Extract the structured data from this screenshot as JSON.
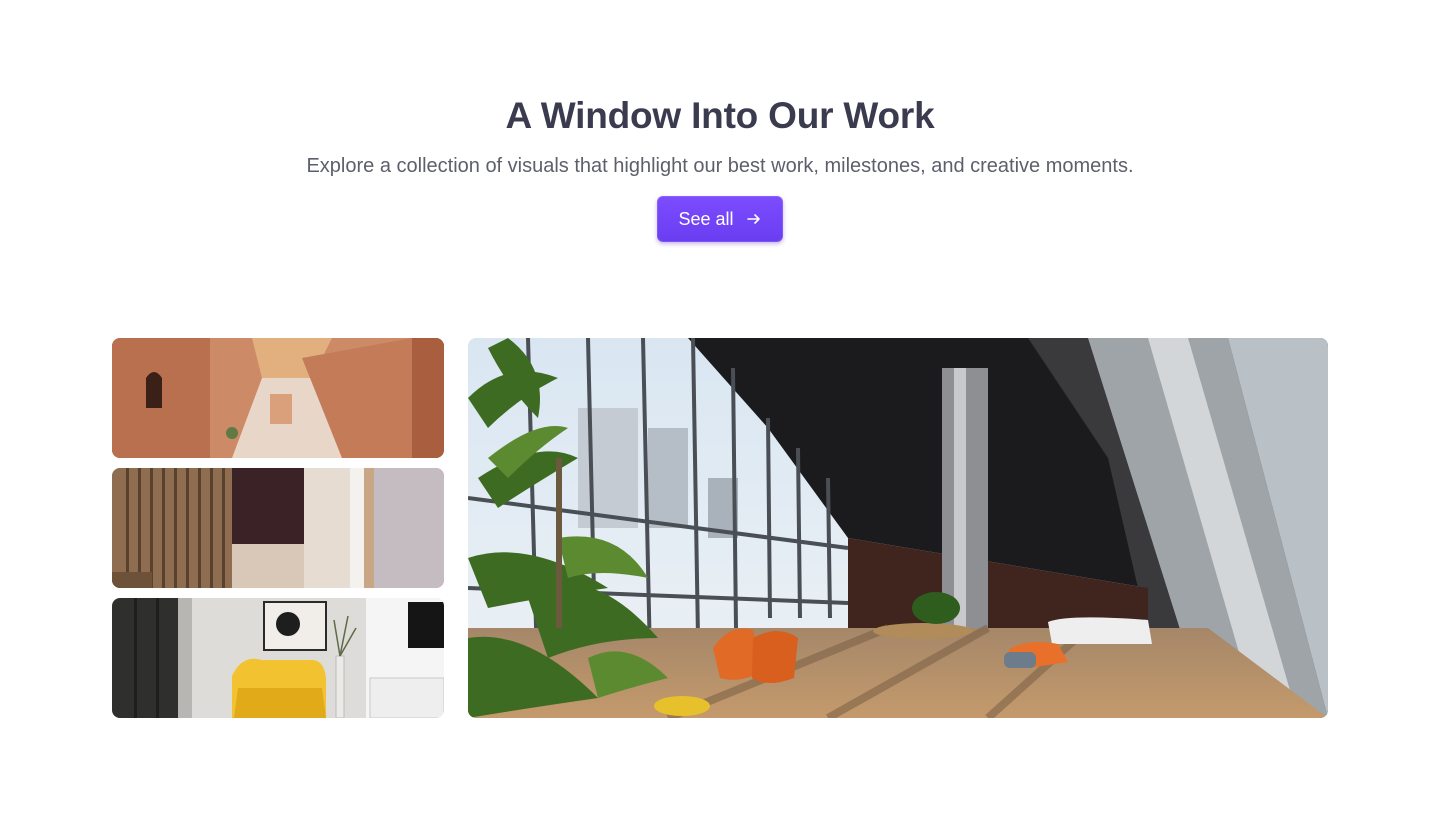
{
  "header": {
    "title": "A Window Into Our Work",
    "subtitle": "Explore a collection of visuals that highlight our best work, milestones, and creative moments.",
    "cta_label": "See all",
    "cta_icon": "arrow-right-icon"
  },
  "colors": {
    "accent": "#7c4dff",
    "title": "#3b3b4f",
    "subtitle": "#5d5f6b"
  },
  "gallery": {
    "images": [
      {
        "name": "terracotta-archway-photo"
      },
      {
        "name": "wood-slat-interior-photo"
      },
      {
        "name": "yellow-armchair-living-room-photo"
      },
      {
        "name": "office-lobby-atrium-photo"
      }
    ]
  }
}
